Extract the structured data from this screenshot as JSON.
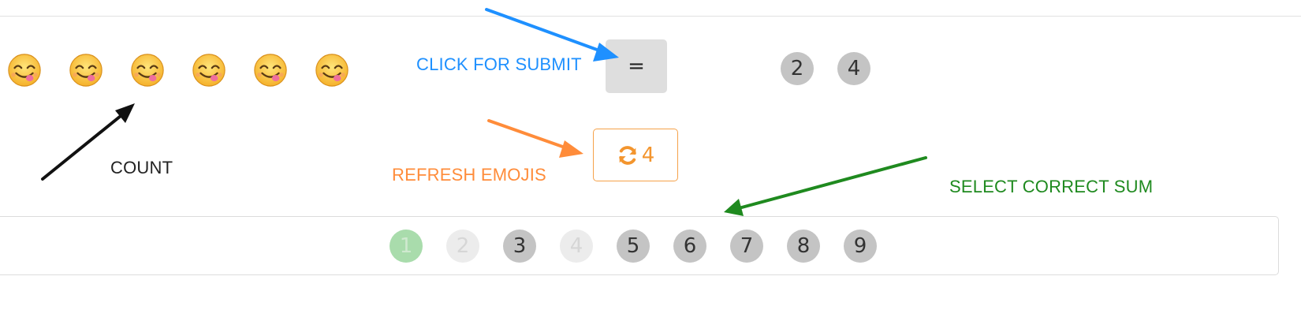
{
  "emoji_count": 6,
  "emojis": [
    {
      "name": "face-savoring-food-icon"
    },
    {
      "name": "face-savoring-food-icon"
    },
    {
      "name": "face-savoring-food-icon"
    },
    {
      "name": "face-savoring-food-icon"
    },
    {
      "name": "face-savoring-food-icon"
    },
    {
      "name": "face-savoring-food-icon"
    }
  ],
  "annotations": {
    "submit": "CLICK FOR SUBMIT",
    "refresh": "REFRESH EMOJIS",
    "count": "COUNT",
    "sum": "SELECT CORRECT SUM"
  },
  "annotation_colors": {
    "submit": "#1e90ff",
    "refresh": "#ff8c3a",
    "count": "#111111",
    "sum": "#1f8a1f"
  },
  "submit_button": {
    "label": "="
  },
  "selected_numbers": [
    "2",
    "4"
  ],
  "refresh_button": {
    "icon": "refresh-icon",
    "count": "4"
  },
  "answer_options": [
    {
      "label": "1",
      "state": "correct-used"
    },
    {
      "label": "2",
      "state": "disabled"
    },
    {
      "label": "3",
      "state": "available"
    },
    {
      "label": "4",
      "state": "disabled"
    },
    {
      "label": "5",
      "state": "available"
    },
    {
      "label": "6",
      "state": "available"
    },
    {
      "label": "7",
      "state": "available"
    },
    {
      "label": "8",
      "state": "available"
    },
    {
      "label": "9",
      "state": "available"
    }
  ]
}
